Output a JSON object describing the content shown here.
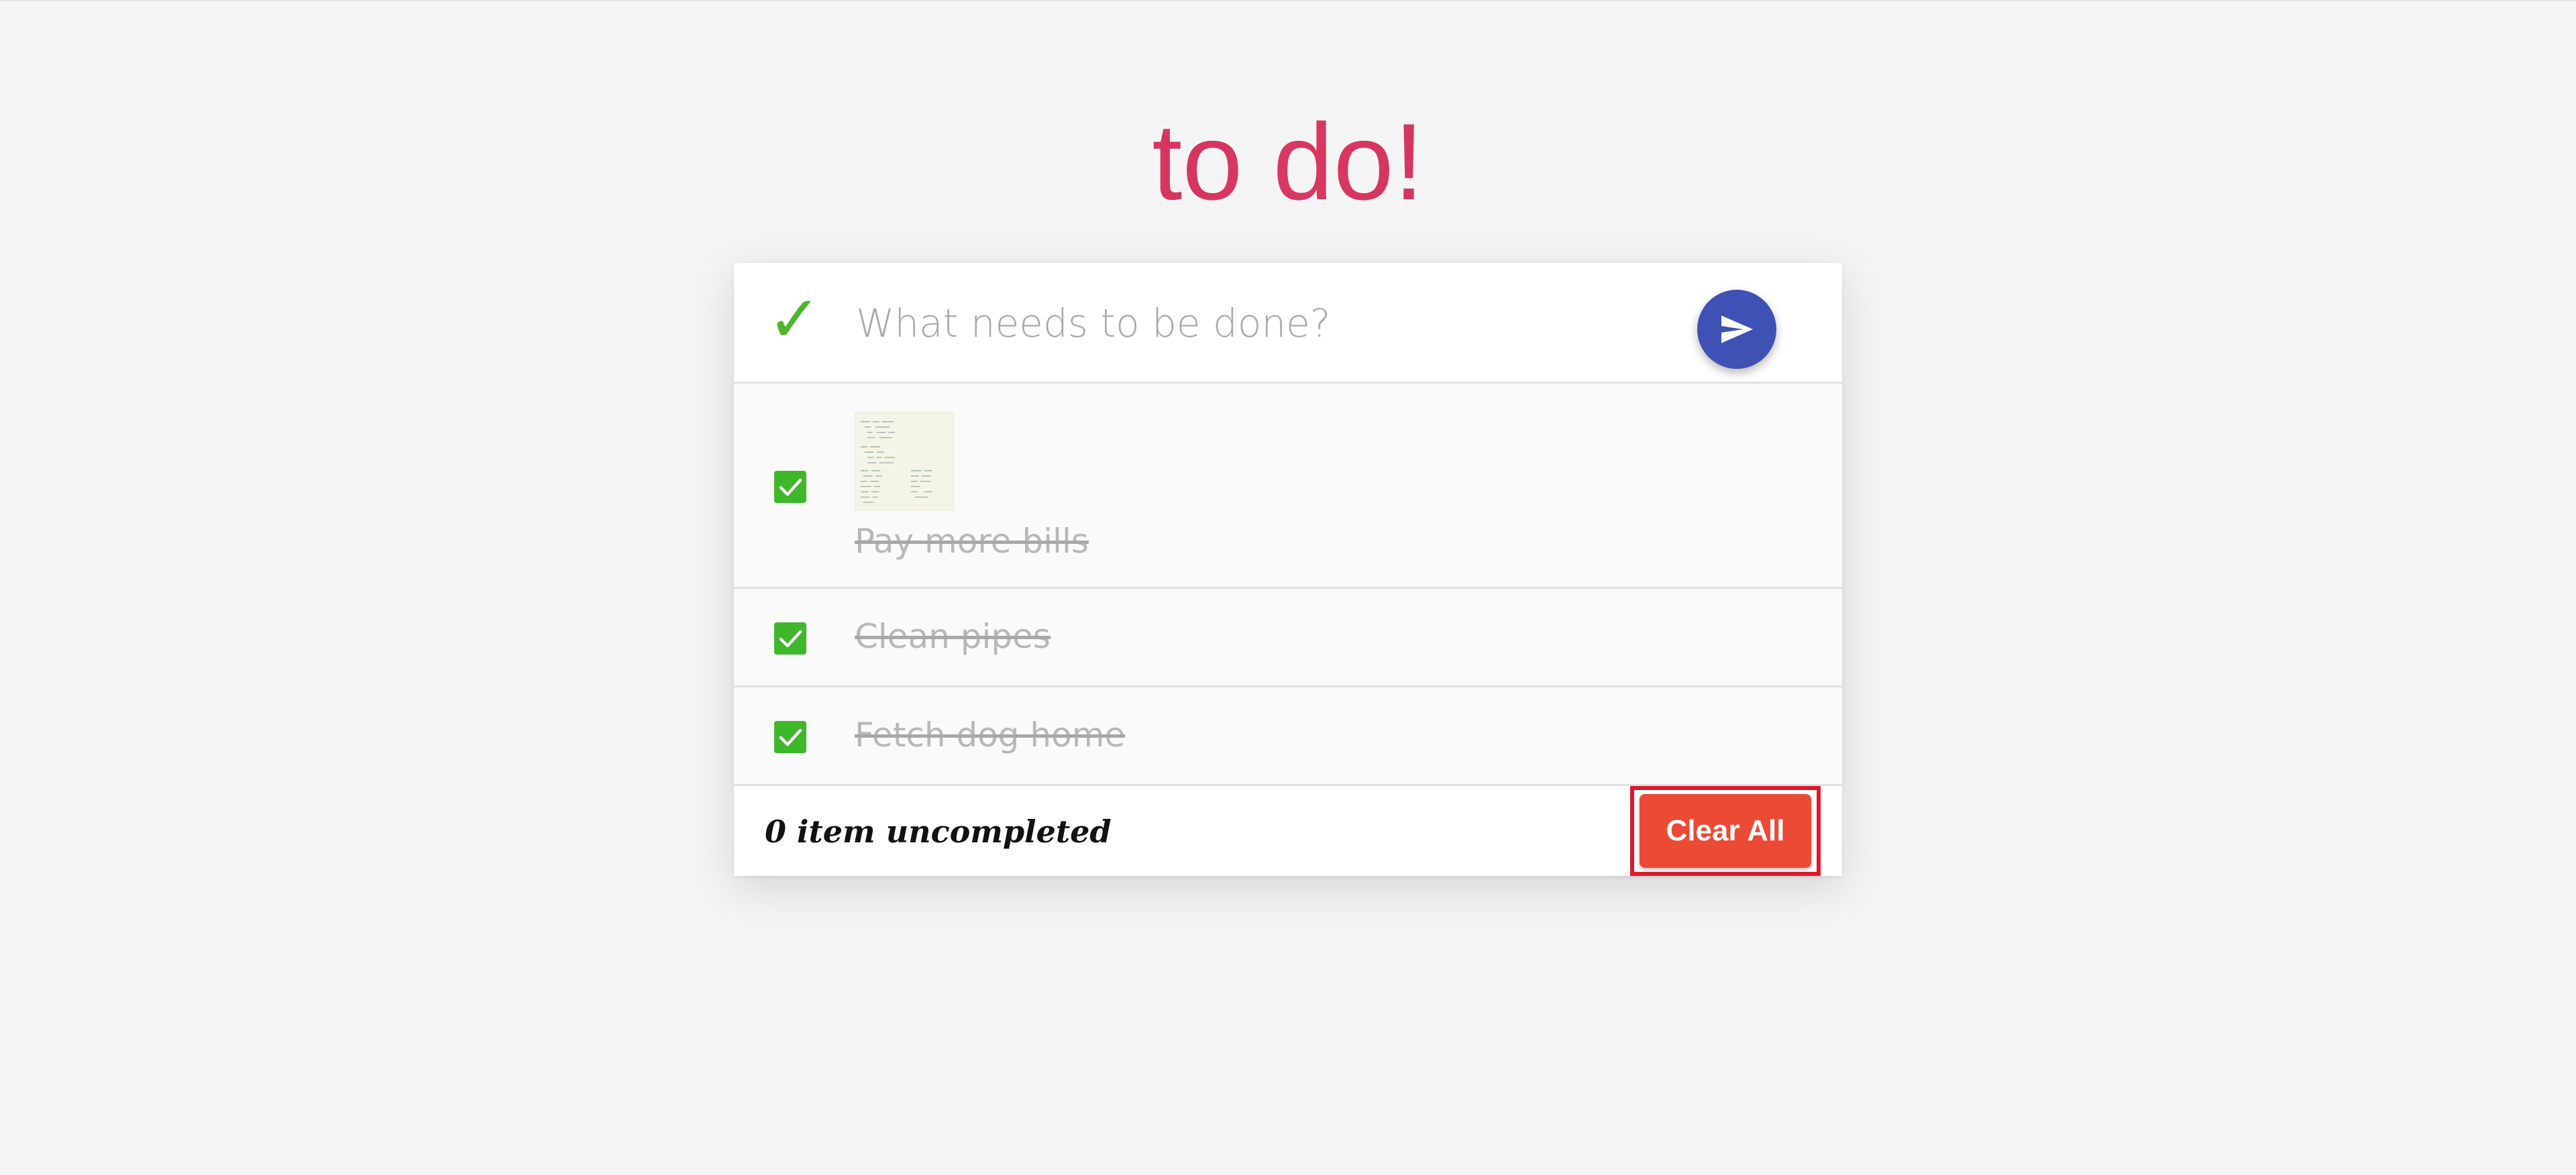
{
  "app": {
    "title": "to do!"
  },
  "input": {
    "placeholder": "What needs to be done?",
    "value": "",
    "toggle_icon": "checkmark-icon",
    "send_icon": "send-icon"
  },
  "todos": [
    {
      "text": "Pay more bills",
      "completed": true,
      "has_image": true
    },
    {
      "text": "Clean pipes",
      "completed": true,
      "has_image": false
    },
    {
      "text": "Fetch dog home",
      "completed": true,
      "has_image": false
    }
  ],
  "footer": {
    "count_text": "0 item uncompleted",
    "clear_label": "Clear All"
  },
  "colors": {
    "title": "#c72a4b",
    "check": "#4db62c",
    "checkbox": "#3fb72b",
    "send_button": "#3f51b5",
    "clear_button": "#eb4a35",
    "highlight_outline": "#e0172a"
  }
}
